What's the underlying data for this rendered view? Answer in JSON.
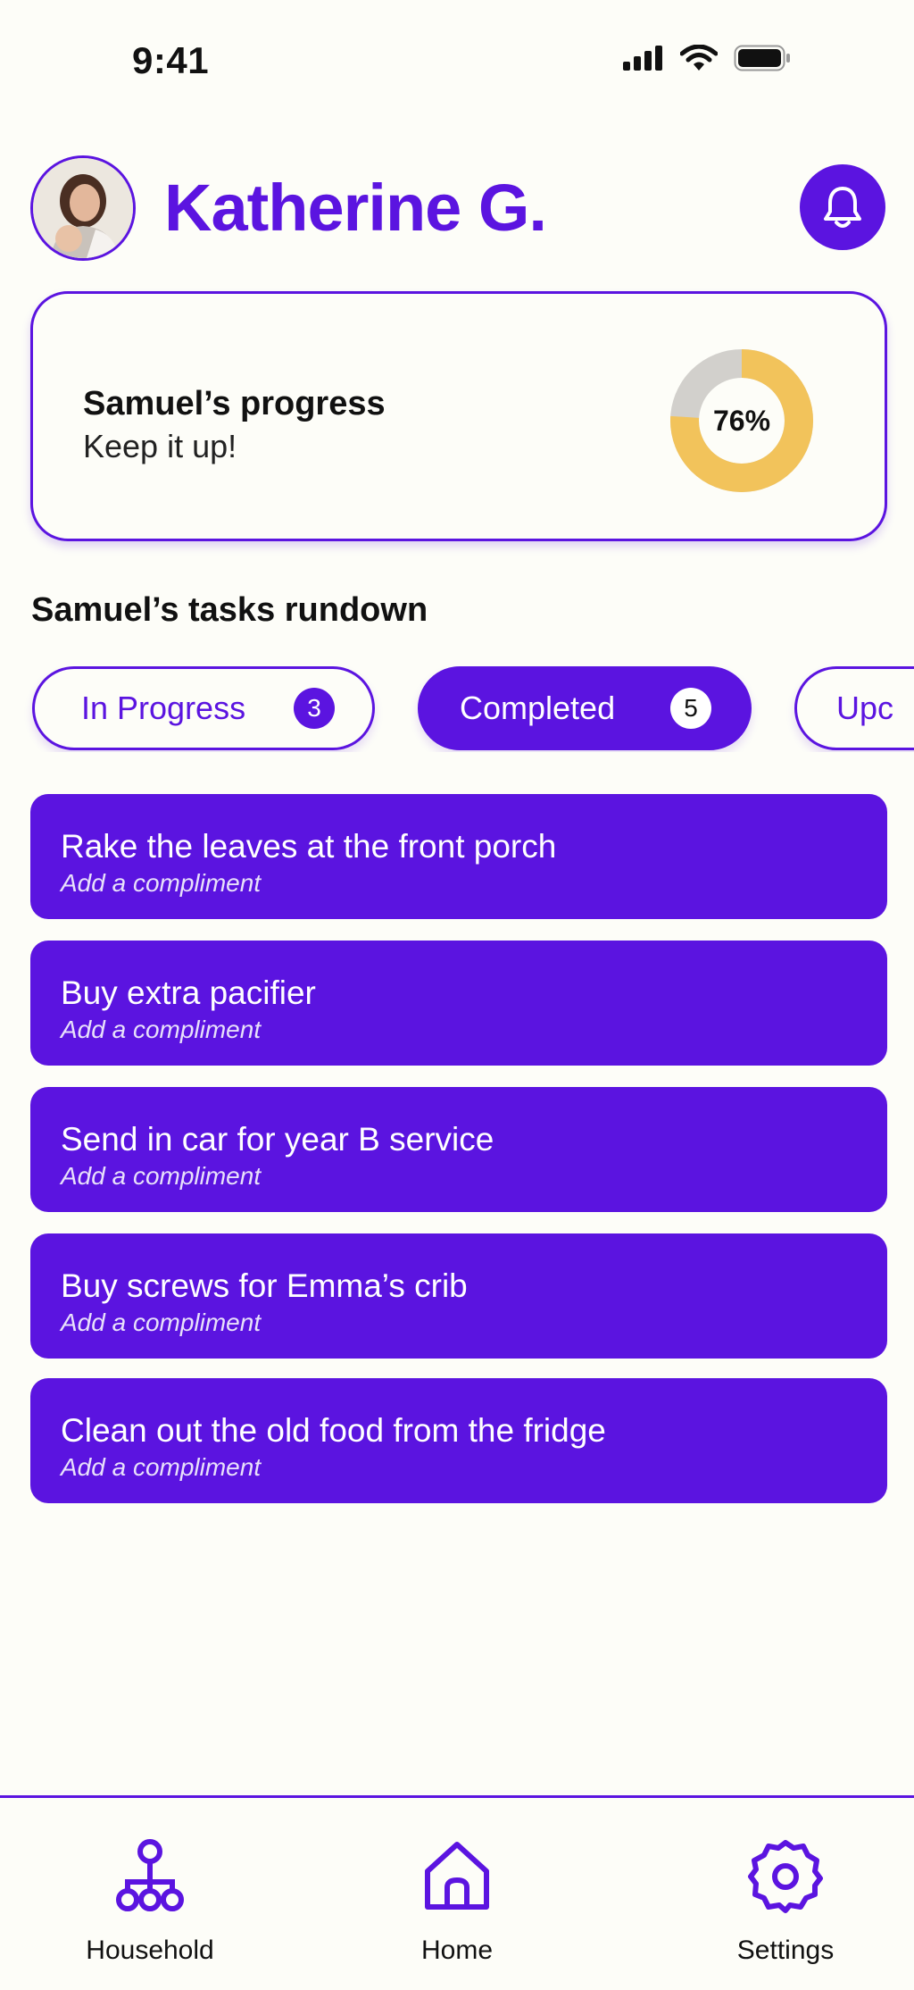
{
  "status_bar": {
    "time": "9:41"
  },
  "header": {
    "user_name": "Katherine G.",
    "avatar_alt": "Profile photo"
  },
  "progress_card": {
    "title": "Samuel’s progress",
    "subtitle": "Keep it up!",
    "percent": 76,
    "percent_label": "76%",
    "colors": {
      "fill": "#f2c35b",
      "track": "#d2d0cc"
    }
  },
  "tasks_section": {
    "title": "Samuel’s tasks rundown"
  },
  "filters": [
    {
      "label": "In Progress",
      "count": "3",
      "selected": false
    },
    {
      "label": "Completed",
      "count": "5",
      "selected": true
    },
    {
      "label": "Upc",
      "selected": false
    }
  ],
  "tasks": [
    {
      "title": "Rake the leaves at the front porch",
      "subtitle": "Add a compliment"
    },
    {
      "title": "Buy extra pacifier",
      "subtitle": "Add a compliment"
    },
    {
      "title": "Send in car for year B service",
      "subtitle": "Add a compliment"
    },
    {
      "title": "Buy screws for Emma’s crib",
      "subtitle": "Add a compliment"
    },
    {
      "title": "Clean out the old food from the fridge",
      "subtitle": "Add a compliment"
    }
  ],
  "tab_bar": {
    "items": [
      {
        "label": "Household",
        "icon": "household-icon"
      },
      {
        "label": "Home",
        "icon": "home-icon"
      },
      {
        "label": "Settings",
        "icon": "settings-icon"
      }
    ]
  },
  "colors": {
    "accent": "#5b14e0",
    "background": "#fdfdf8"
  }
}
